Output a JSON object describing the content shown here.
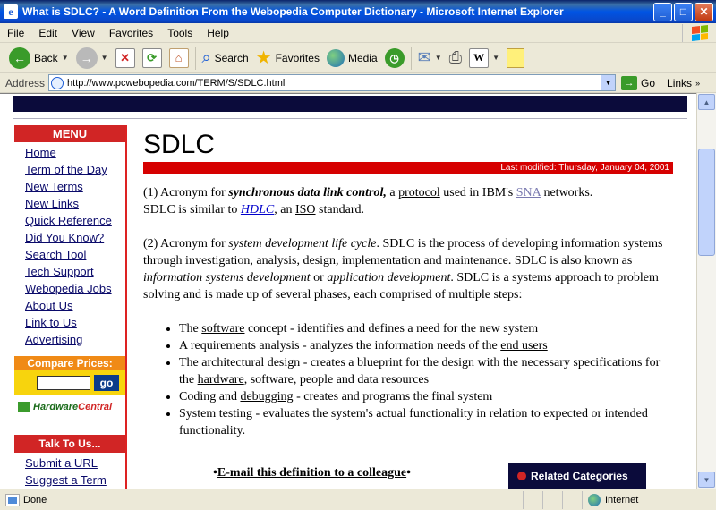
{
  "window": {
    "title": "What is SDLC? - A Word Definition From the Webopedia Computer Dictionary - Microsoft Internet Explorer",
    "minimize": "_",
    "maximize": "□",
    "close": "✕"
  },
  "menubar": [
    "File",
    "Edit",
    "View",
    "Favorites",
    "Tools",
    "Help"
  ],
  "toolbar": {
    "back": "Back",
    "search": "Search",
    "favorites": "Favorites",
    "media": "Media"
  },
  "address": {
    "label": "Address",
    "url": "http://www.pcwebopedia.com/TERM/S/SDLC.html",
    "go": "Go",
    "links": "Links"
  },
  "sidebar": {
    "menu_title": "MENU",
    "items": [
      "Home",
      "Term of the Day",
      "New Terms",
      "New Links",
      "Quick Reference",
      "Did You Know?",
      "Search Tool",
      "Tech Support",
      "Webopedia Jobs",
      "About Us",
      "Link to Us",
      "Advertising"
    ],
    "compare_title": "Compare Prices:",
    "compare_go": "go",
    "hwc_logo_1": "Hardware",
    "hwc_logo_2": "Central",
    "talk_title": "Talk To Us...",
    "talk_items": [
      "Submit a URL",
      "Suggest a Term"
    ]
  },
  "content": {
    "term": "SDLC",
    "last_modified": "Last modified: Thursday, January 04, 2001",
    "p1": {
      "a": "(1) Acronym for ",
      "b": "synchronous data link control,",
      "c": " a ",
      "protocol": "protocol",
      "d": " used in IBM's ",
      "sna": "SNA",
      "e": " networks.",
      "f": "SDLC is similar to ",
      "hdlc": "HDLC",
      "g": ", an ",
      "iso": "ISO",
      "h": " standard."
    },
    "p2": {
      "a": "(2) Acronym for ",
      "b": "system development life cycle",
      "c": ". SDLC is the process of developing information systems through investigation, analysis, design, implementation and maintenance. SDLC is also known as ",
      "d": "information systems development",
      "e": " or ",
      "f": "application development",
      "g": ". SDLC is a systems approach to problem solving and is made up of several phases, each comprised of multiple steps:"
    },
    "bullets": {
      "b1a": "The ",
      "b1link": "software",
      "b1b": " concept - identifies and defines a need for the new system",
      "b2a": "A requirements analysis - analyzes the information needs of the ",
      "b2link": "end users",
      "b3a": "The architectural design - creates a blueprint for the design with the necessary specifications for the ",
      "b3link": "hardware",
      "b3b": ", software, people and data resources",
      "b4a": "Coding and ",
      "b4link": "debugging",
      "b4b": " - creates and programs the final system",
      "b5a": "System testing - evaluates the system's actual functionality in relation to expected or intended functionality."
    },
    "email_link": "E-mail this definition to a colleague",
    "related": "Related Categories"
  },
  "status": {
    "text": "Done",
    "zone": "Internet"
  }
}
